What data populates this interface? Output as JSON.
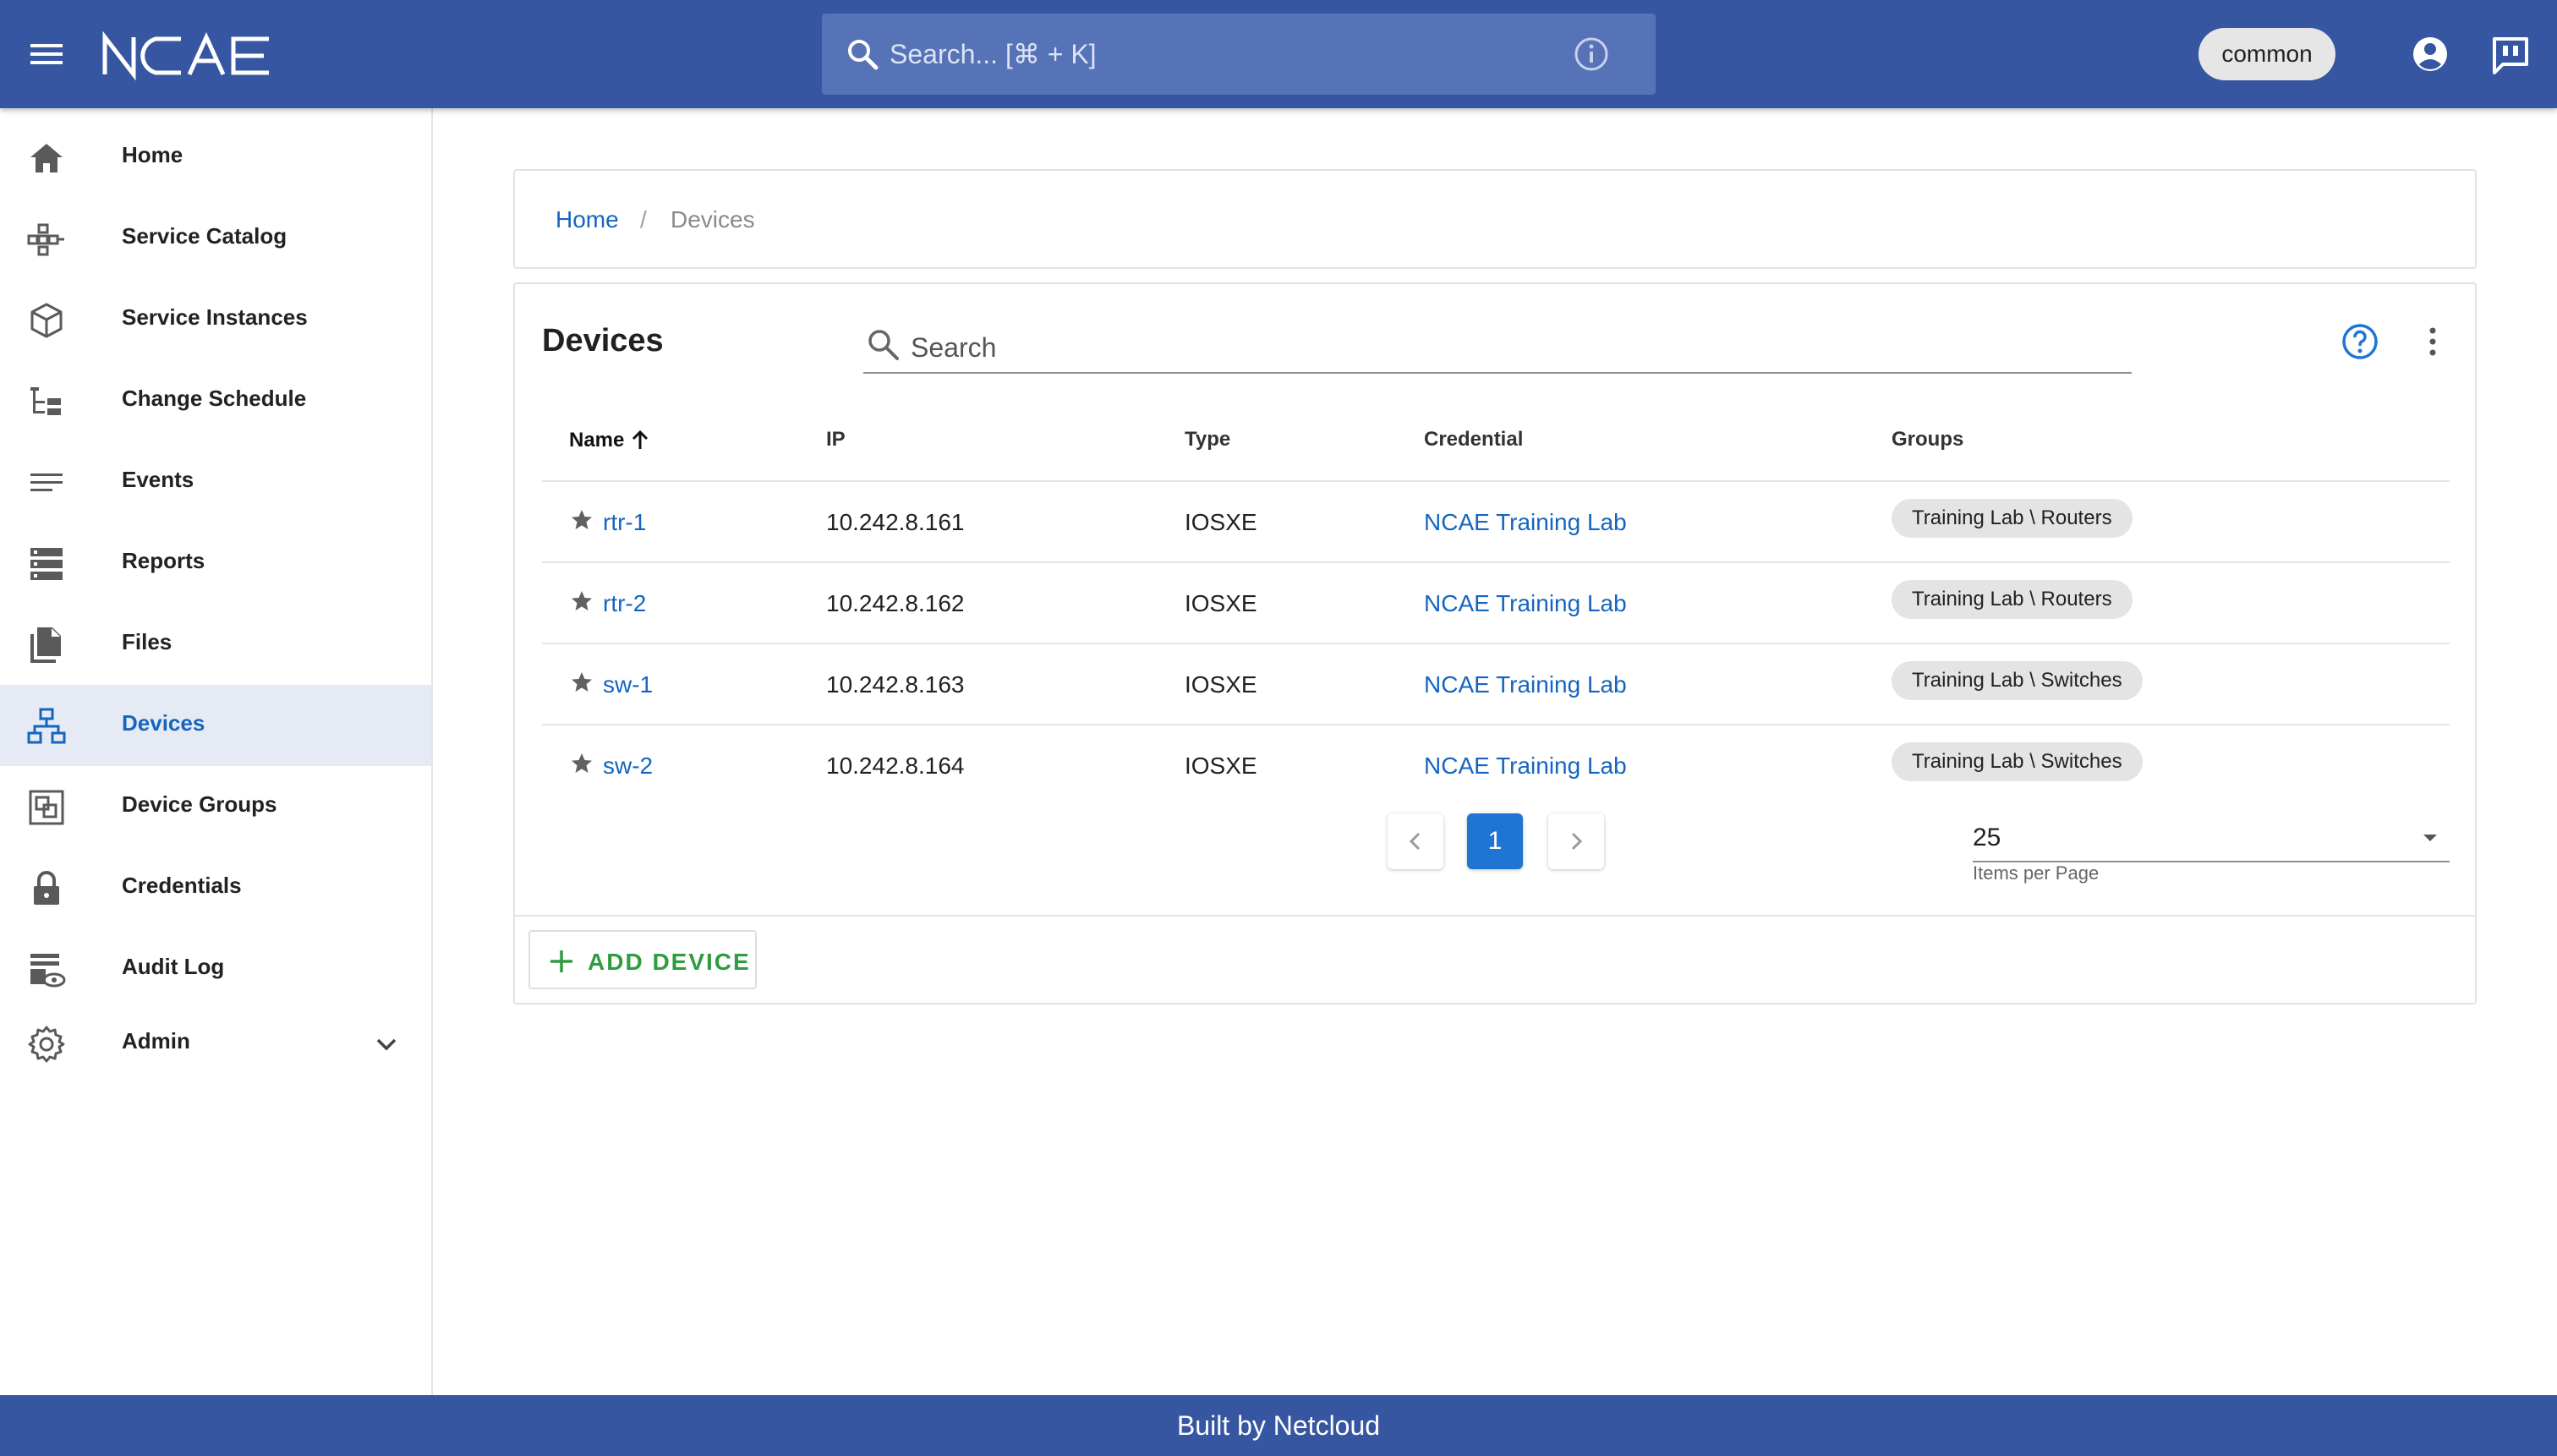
{
  "header": {
    "logo_text": "NCAE",
    "search_placeholder": "Search... [⌘ + K]",
    "tenant": "common"
  },
  "sidebar": {
    "items": [
      {
        "label": "Home",
        "icon": "home-icon"
      },
      {
        "label": "Service Catalog",
        "icon": "service-catalog-icon"
      },
      {
        "label": "Service Instances",
        "icon": "cube-icon"
      },
      {
        "label": "Change Schedule",
        "icon": "schedule-tree-icon"
      },
      {
        "label": "Events",
        "icon": "events-lines-icon"
      },
      {
        "label": "Reports",
        "icon": "reports-icon"
      },
      {
        "label": "Files",
        "icon": "files-icon"
      },
      {
        "label": "Devices",
        "icon": "network-devices-icon",
        "active": true
      },
      {
        "label": "Device Groups",
        "icon": "device-groups-icon"
      },
      {
        "label": "Credentials",
        "icon": "lock-icon"
      },
      {
        "label": "Audit Log",
        "icon": "audit-log-icon"
      },
      {
        "label": "Admin",
        "icon": "gear-icon",
        "expandable": true
      }
    ]
  },
  "breadcrumb": {
    "home": "Home",
    "separator": "/",
    "current": "Devices"
  },
  "devices": {
    "title": "Devices",
    "search_placeholder": "Search",
    "columns": {
      "name": "Name",
      "ip": "IP",
      "type": "Type",
      "credential": "Credential",
      "groups": "Groups"
    },
    "rows": [
      {
        "name": "rtr-1",
        "ip": "10.242.8.161",
        "type": "IOSXE",
        "credential": "NCAE Training Lab",
        "group": "Training Lab \\ Routers"
      },
      {
        "name": "rtr-2",
        "ip": "10.242.8.162",
        "type": "IOSXE",
        "credential": "NCAE Training Lab",
        "group": "Training Lab \\ Routers"
      },
      {
        "name": "sw-1",
        "ip": "10.242.8.163",
        "type": "IOSXE",
        "credential": "NCAE Training Lab",
        "group": "Training Lab \\ Switches"
      },
      {
        "name": "sw-2",
        "ip": "10.242.8.164",
        "type": "IOSXE",
        "credential": "NCAE Training Lab",
        "group": "Training Lab \\ Switches"
      }
    ],
    "pagination": {
      "current_page": "1",
      "items_per_page": "25",
      "items_per_page_label": "Items per Page"
    },
    "add_button_label": "ADD DEVICE"
  },
  "footer": {
    "text": "Built by Netcloud"
  },
  "colors": {
    "header_bg": "#3756a2",
    "link": "#1565c0",
    "accent_green": "#2e9c40",
    "active_page": "#1e76d2",
    "active_nav_bg": "#e6eaf4"
  }
}
